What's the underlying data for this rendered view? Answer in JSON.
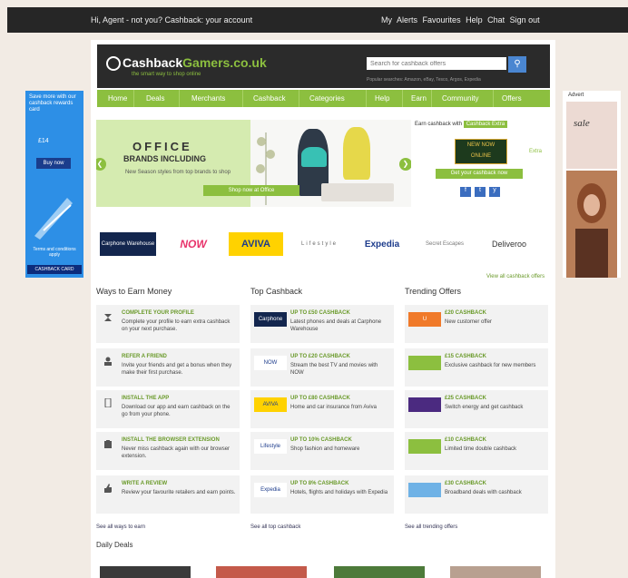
{
  "topbar": {
    "welcome": "Hi, Agent - not you? Cashback: your account",
    "links": [
      "My",
      "Alerts",
      "Favourites",
      "Help",
      "Chat",
      "Sign out"
    ]
  },
  "header": {
    "logo_text_1": "Cashback",
    "logo_text_2": "Gamers.co.uk",
    "logo_tagline": "the smart way to shop online",
    "search_placeholder": "Search for cashback offers",
    "search_sub": "Popular searches: Amazon, eBay, Tesco, Argos, Expedia"
  },
  "nav": {
    "items": [
      "Home",
      "Deals",
      "Merchants",
      "Cashback",
      "Categories",
      "Help",
      "Earn",
      "Community",
      "Offers"
    ]
  },
  "hero": {
    "title": "OFFICE",
    "subtitle": "BRANDS INCLUDING",
    "text": "New Season styles from top brands to shop",
    "cta": "Shop now at Office"
  },
  "promo": {
    "top_text": "Earn cashback with",
    "top_badge": "Cashback Extra",
    "badge_line1": "NEW NOW",
    "badge_line2": "ONLINE",
    "side": "Extra",
    "cta": "Get your cashback now",
    "social": [
      "f",
      "t",
      "y"
    ]
  },
  "brands": [
    "Carphone Warehouse",
    "NOW",
    "AVIVA",
    "Lifestyle",
    "Expedia",
    "Secret Escapes",
    "Deliveroo"
  ],
  "more_link": "View all cashback offers",
  "columns": {
    "ways": {
      "title": "Ways to Earn Money",
      "items": [
        {
          "icon": "hourglass-icon",
          "title": "COMPLETE YOUR PROFILE",
          "desc": "Complete your profile to earn extra cashback on your next purchase."
        },
        {
          "icon": "person-icon",
          "title": "REFER A FRIEND",
          "desc": "Invite your friends and get a bonus when they make their first purchase."
        },
        {
          "icon": "phone-icon",
          "title": "INSTALL THE APP",
          "desc": "Download our app and earn cashback on the go from your phone."
        },
        {
          "icon": "puzzle-icon",
          "title": "INSTALL THE BROWSER EXTENSION",
          "desc": "Never miss cashback again with our browser extension."
        },
        {
          "icon": "thumbs-up-icon",
          "title": "WRITE A REVIEW",
          "desc": "Review your favourite retailers and earn points."
        }
      ]
    },
    "top": {
      "title": "Top Cashback",
      "items": [
        {
          "logo": "Carphone",
          "color": "#13264e",
          "title": "UP TO £50 CASHBACK",
          "desc": "Latest phones and deals at Carphone Warehouse"
        },
        {
          "logo": "NOW",
          "color": "#ffffff",
          "title": "UP TO £20 CASHBACK",
          "desc": "Stream the best TV and movies with NOW"
        },
        {
          "logo": "AVIVA",
          "color": "#ffd200",
          "title": "UP TO £80 CASHBACK",
          "desc": "Home and car insurance from Aviva"
        },
        {
          "logo": "Lifestyle",
          "color": "#ffffff",
          "title": "UP TO 10% CASHBACK",
          "desc": "Shop fashion and homeware"
        },
        {
          "logo": "Expedia",
          "color": "#ffffff",
          "title": "UP TO 8% CASHBACK",
          "desc": "Hotels, flights and holidays with Expedia"
        }
      ]
    },
    "trending": {
      "title": "Trending Offers",
      "items": [
        {
          "logo": "U",
          "color": "#f07a2a",
          "title": "£20 CASHBACK",
          "desc": "New customer offer"
        },
        {
          "logo": "",
          "color": "#8cbf3f",
          "title": "£15 CASHBACK",
          "desc": "Exclusive cashback for new members"
        },
        {
          "logo": "",
          "color": "#4b2a80",
          "title": "£25 CASHBACK",
          "desc": "Switch energy and get cashback"
        },
        {
          "logo": "",
          "color": "#8cbf3f",
          "title": "£10 CASHBACK",
          "desc": "Limited time double cashback"
        },
        {
          "logo": "",
          "color": "#6fb2e6",
          "title": "£30 CASHBACK",
          "desc": "Broadband deals with cashback"
        }
      ]
    }
  },
  "footer_links": [
    "See all ways to earn",
    "See all top cashback",
    "See all trending offers"
  ],
  "daily": {
    "title": "Daily Deals"
  },
  "ad_left": {
    "line1": "Save more with our cashback rewards card",
    "price": "£14",
    "cta": "Buy now",
    "small": "Terms and conditions apply",
    "brand": "CASHBACK CARD"
  },
  "ad_right": {
    "label": "Advert",
    "sale": "sale"
  }
}
